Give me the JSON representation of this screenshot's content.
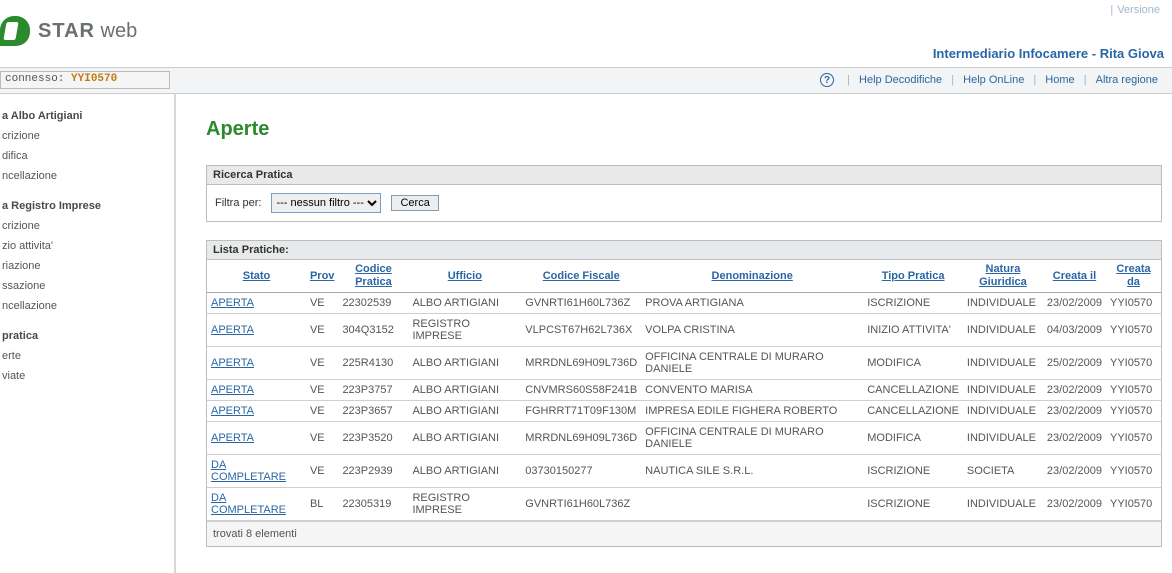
{
  "banner": {
    "version_label": "Versione",
    "app_name_bold": "STAR",
    "app_name_rest": " web",
    "subtitle": "Intermediario Infocamere - Rita Giova"
  },
  "nav": {
    "connesso_label": "connesso:",
    "connesso_user": "YYI0570",
    "links": {
      "help_decod": "Help Decodifiche",
      "help_online": "Help OnLine",
      "home": "Home",
      "altra_regione": "Altra regione"
    }
  },
  "sidebar": {
    "g1_title": "a Albo Artigiani",
    "g1_items": [
      "crizione",
      "difica",
      "ncellazione"
    ],
    "g2_title": "a Registro Imprese",
    "g2_items": [
      "crizione",
      "zio attivita'",
      "riazione",
      "ssazione",
      "ncellazione"
    ],
    "g3_title": "pratica",
    "g3_items": [
      "erte",
      "viate"
    ]
  },
  "page": {
    "title": "Aperte",
    "filter_panel_title": "Ricerca Pratica",
    "filter_label": "Filtra per:",
    "filter_selected": "--- nessun filtro ---",
    "filter_button": "Cerca",
    "list_panel_title": "Lista Pratiche:",
    "columns": {
      "stato": "Stato",
      "prov": "Prov",
      "codice_pratica": "Codice Pratica",
      "ufficio": "Ufficio",
      "codice_fiscale": "Codice Fiscale",
      "denominazione": "Denominazione",
      "tipo_pratica": "Tipo Pratica",
      "natura_giuridica": "Natura Giuridica",
      "creata_il": "Creata il",
      "creata_da": "Creata da"
    },
    "rows": [
      {
        "stato": "APERTA",
        "prov": "VE",
        "codice": "22302539",
        "ufficio": "ALBO ARTIGIANI",
        "cf": "GVNRTI61H60L736Z",
        "denom": "PROVA ARTIGIANA",
        "tipo": "ISCRIZIONE",
        "natura": "INDIVIDUALE",
        "il": "23/02/2009",
        "da": "YYI0570"
      },
      {
        "stato": "APERTA",
        "prov": "VE",
        "codice": "304Q3152",
        "ufficio": "REGISTRO IMPRESE",
        "cf": "VLPCST67H62L736X",
        "denom": "VOLPA CRISTINA",
        "tipo": "INIZIO ATTIVITA'",
        "natura": "INDIVIDUALE",
        "il": "04/03/2009",
        "da": "YYI0570"
      },
      {
        "stato": "APERTA",
        "prov": "VE",
        "codice": "225R4130",
        "ufficio": "ALBO ARTIGIANI",
        "cf": "MRRDNL69H09L736D",
        "denom": "OFFICINA CENTRALE DI MURARO DANIELE",
        "tipo": "MODIFICA",
        "natura": "INDIVIDUALE",
        "il": "25/02/2009",
        "da": "YYI0570"
      },
      {
        "stato": "APERTA",
        "prov": "VE",
        "codice": "223P3757",
        "ufficio": "ALBO ARTIGIANI",
        "cf": "CNVMRS60S58F241B",
        "denom": "CONVENTO MARISA",
        "tipo": "CANCELLAZIONE",
        "natura": "INDIVIDUALE",
        "il": "23/02/2009",
        "da": "YYI0570"
      },
      {
        "stato": "APERTA",
        "prov": "VE",
        "codice": "223P3657",
        "ufficio": "ALBO ARTIGIANI",
        "cf": "FGHRRT71T09F130M",
        "denom": "IMPRESA EDILE FIGHERA ROBERTO",
        "tipo": "CANCELLAZIONE",
        "natura": "INDIVIDUALE",
        "il": "23/02/2009",
        "da": "YYI0570"
      },
      {
        "stato": "APERTA",
        "prov": "VE",
        "codice": "223P3520",
        "ufficio": "ALBO ARTIGIANI",
        "cf": "MRRDNL69H09L736D",
        "denom": "OFFICINA CENTRALE DI MURARO DANIELE",
        "tipo": "MODIFICA",
        "natura": "INDIVIDUALE",
        "il": "23/02/2009",
        "da": "YYI0570"
      },
      {
        "stato": "DA COMPLETARE",
        "prov": "VE",
        "codice": "223P2939",
        "ufficio": "ALBO ARTIGIANI",
        "cf": "03730150277",
        "denom": "NAUTICA SILE S.R.L.",
        "tipo": "ISCRIZIONE",
        "natura": "SOCIETA",
        "il": "23/02/2009",
        "da": "YYI0570"
      },
      {
        "stato": "DA COMPLETARE",
        "prov": "BL",
        "codice": "22305319",
        "ufficio": "REGISTRO IMPRESE",
        "cf": "GVNRTI61H60L736Z",
        "denom": "",
        "tipo": "ISCRIZIONE",
        "natura": "INDIVIDUALE",
        "il": "23/02/2009",
        "da": "YYI0570"
      }
    ],
    "footer": "trovati 8  elementi"
  }
}
